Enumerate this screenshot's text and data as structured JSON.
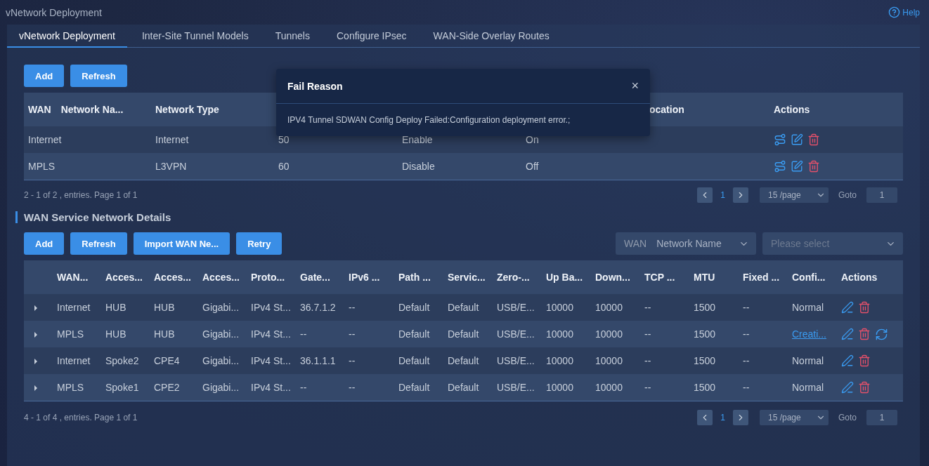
{
  "page_title": "vNetwork Deployment",
  "help": "Help",
  "tabs": [
    {
      "label": "vNetwork Deployment",
      "selected": true
    },
    {
      "label": "Inter-Site Tunnel Models",
      "selected": false
    },
    {
      "label": "Tunnels",
      "selected": false
    },
    {
      "label": "Configure IPsec",
      "selected": false
    },
    {
      "label": "WAN-Side Overlay Routes",
      "selected": false
    }
  ],
  "networks": {
    "buttons": [
      "Add",
      "Refresh"
    ],
    "columns": [
      {
        "tag": "WAN",
        "header": "Network Na..."
      },
      {
        "header": "Network Type"
      },
      null,
      null,
      null,
      {
        "header": "ocation"
      },
      {
        "header": "Actions"
      }
    ],
    "rows": [
      {
        "cells": [
          "Internet",
          "Internet",
          "50",
          "Enable",
          "On"
        ]
      },
      {
        "cells": [
          "MPLS",
          "L3VPN",
          "60",
          "Disable",
          "Off"
        ]
      }
    ],
    "summary": "2 - 1 of 2 , entries. Page 1 of 1",
    "pagination": {
      "page": "1",
      "page_size": "15 /page",
      "goto_label": "Goto",
      "goto_value": "1"
    }
  },
  "details": {
    "title": "WAN Service Network Details",
    "buttons": [
      "Add",
      "Refresh",
      "Import WAN Ne...",
      "Retry"
    ],
    "filter": {
      "label": "WAN",
      "value": "Network Name",
      "placeholder": "Please select"
    },
    "columns": [
      "WAN...",
      "Acces...",
      "Acces...",
      "Acces...",
      "Proto...",
      "Gate...",
      "IPv6 ...",
      "Path ...",
      "Servic...",
      "Zero-...",
      "Up Ba...",
      "Down...",
      "TCP ...",
      "MTU",
      "Fixed ...",
      "Confi...",
      "Actions"
    ],
    "rows": [
      {
        "expanded": false,
        "cells": [
          "Internet",
          "HUB",
          "HUB",
          "Gigabi...",
          "IPv4 St...",
          "36.7.1.2",
          "--",
          "Default",
          "Default",
          "USB/E...",
          "10000",
          "10000",
          "--",
          "1500",
          "--"
        ],
        "status": {
          "kind": "text",
          "text": "Normal"
        },
        "retry": false
      },
      {
        "expanded": false,
        "cells": [
          "MPLS",
          "HUB",
          "HUB",
          "Gigabi...",
          "IPv4 St...",
          "--",
          "--",
          "Default",
          "Default",
          "USB/E...",
          "10000",
          "10000",
          "--",
          "1500",
          "--"
        ],
        "status": {
          "kind": "link",
          "text": "Creati..."
        },
        "retry": true
      },
      {
        "expanded": false,
        "cells": [
          "Internet",
          "Spoke2",
          "CPE4",
          "Gigabi...",
          "IPv4 St...",
          "36.1.1.1",
          "--",
          "Default",
          "Default",
          "USB/E...",
          "10000",
          "10000",
          "--",
          "1500",
          "--"
        ],
        "status": {
          "kind": "text",
          "text": "Normal"
        },
        "retry": false
      },
      {
        "expanded": false,
        "cells": [
          "MPLS",
          "Spoke1",
          "CPE2",
          "Gigabi...",
          "IPv4 St...",
          "--",
          "--",
          "Default",
          "Default",
          "USB/E...",
          "10000",
          "10000",
          "--",
          "1500",
          "--"
        ],
        "status": {
          "kind": "text",
          "text": "Normal"
        },
        "retry": false
      }
    ],
    "summary": "4 - 1 of 4 , entries. Page 1 of 1",
    "pagination": {
      "page": "1",
      "page_size": "15 /page",
      "goto_label": "Goto",
      "goto_value": "1"
    }
  },
  "dialog": {
    "title": "Fail Reason",
    "close": "×",
    "message": "IPV4 Tunnel SDWAN Config Deploy Failed:Configuration deployment error.;"
  }
}
